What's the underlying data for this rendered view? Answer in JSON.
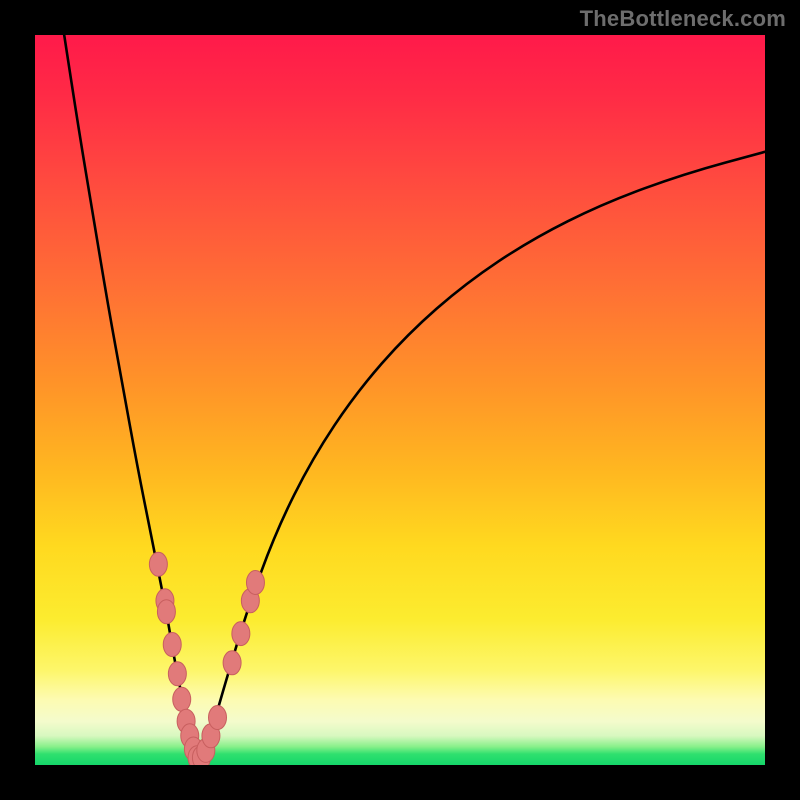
{
  "watermark": "TheBottleneck.com",
  "colors": {
    "curve": "#000000",
    "marker_fill": "#e17a7a",
    "marker_stroke": "#c85f5f",
    "frame": "#000000"
  },
  "chart_data": {
    "type": "line",
    "title": "",
    "xlabel": "",
    "ylabel": "",
    "xlim": [
      0,
      100
    ],
    "ylim": [
      0,
      100
    ],
    "grid": false,
    "legend": null,
    "series": [
      {
        "name": "left-branch",
        "comment": "Descending arm of the V, from top-left into the notch. y ≈ bottleneck percentage (0 at bottom / best).",
        "x": [
          4,
          6,
          8,
          10,
          12,
          14,
          16,
          18,
          19,
          20,
          20.8,
          21.4,
          22,
          22.4
        ],
        "values": [
          100,
          87,
          75,
          63,
          52,
          41,
          31,
          21,
          15,
          10,
          6,
          3,
          1,
          0
        ]
      },
      {
        "name": "right-branch",
        "comment": "Ascending arm, rising rightward with decreasing slope.",
        "x": [
          22.4,
          24,
          26,
          29,
          33,
          38,
          44,
          51,
          59,
          68,
          78,
          89,
          100
        ],
        "values": [
          0,
          4,
          11,
          21,
          32,
          42,
          51,
          59,
          66,
          72,
          77,
          81,
          84
        ]
      }
    ],
    "markers": {
      "comment": "Pink bead-like sample points clustered around the notch on both arms.",
      "x": [
        16.9,
        17.8,
        18.0,
        18.8,
        19.5,
        20.1,
        20.7,
        21.2,
        21.7,
        22.2,
        22.8,
        23.4,
        24.1,
        25.0,
        27.0,
        28.2,
        29.5,
        30.2
      ],
      "values": [
        27.5,
        22.5,
        21.0,
        16.5,
        12.5,
        9.0,
        6.0,
        4.0,
        2.2,
        1.0,
        1.0,
        2.0,
        4.0,
        6.5,
        14.0,
        18.0,
        22.5,
        25.0
      ]
    }
  }
}
